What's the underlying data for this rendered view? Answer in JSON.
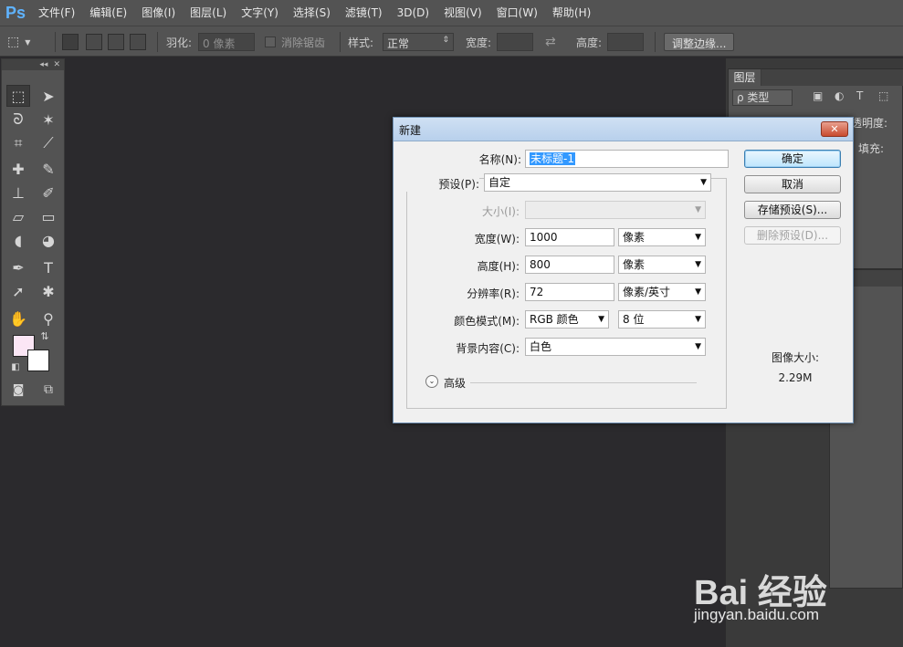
{
  "app": {
    "logo": "Ps"
  },
  "menu": [
    "文件(F)",
    "编辑(E)",
    "图像(I)",
    "图层(L)",
    "文字(Y)",
    "选择(S)",
    "滤镜(T)",
    "3D(D)",
    "视图(V)",
    "窗口(W)",
    "帮助(H)"
  ],
  "options": {
    "feather_label": "羽化:",
    "feather_value": "0 像素",
    "antialias_label": "消除锯齿",
    "style_label": "样式:",
    "style_value": "正常",
    "width_label": "宽度:",
    "height_label": "高度:",
    "refine_edge_button": "调整边缘..."
  },
  "layers_panel": {
    "tab": "图层",
    "filter": "ρ 类型",
    "opacity_label": "透明度:",
    "fill_label": "填充:"
  },
  "dialog": {
    "title": "新建",
    "close": "✕",
    "name_label": "名称(N):",
    "name_value": "未标题-1",
    "preset_label": "预设(P):",
    "preset_value": "自定",
    "size_label": "大小(I):",
    "width_label": "宽度(W):",
    "width_value": "1000",
    "width_unit": "像素",
    "height_label": "高度(H):",
    "height_value": "800",
    "height_unit": "像素",
    "resolution_label": "分辨率(R):",
    "resolution_value": "72",
    "resolution_unit": "像素/英寸",
    "color_mode_label": "颜色模式(M):",
    "color_mode_value": "RGB 颜色",
    "bit_depth_value": "8 位",
    "background_label": "背景内容(C):",
    "background_value": "白色",
    "advanced_label": "高级",
    "ok_button": "确定",
    "cancel_button": "取消",
    "save_preset_button": "存储预设(S)...",
    "delete_preset_button": "删除预设(D)...",
    "image_size_label": "图像大小:",
    "image_size_value": "2.29M"
  },
  "watermark": {
    "brand": "Bai 经验",
    "url": "jingyan.baidu.com"
  },
  "colors": {
    "foreground": "#fbe6f5",
    "background": "#ffffff",
    "accent": "#3399ff"
  }
}
